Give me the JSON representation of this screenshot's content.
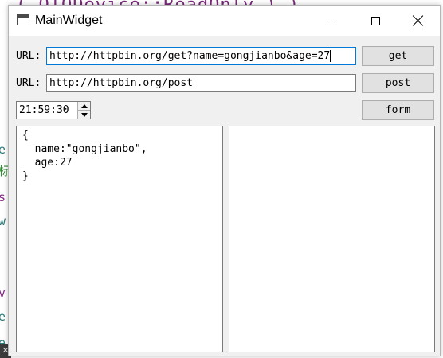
{
  "window": {
    "title": "MainWidget",
    "icon": "app-window-icon"
  },
  "background": {
    "top_text": "( QIODevice::ReadOnly ) )",
    "side_chars": [
      "e",
      "标",
      "s",
      "w",
      "",
      "v",
      "e",
      "e"
    ]
  },
  "row1": {
    "label": "URL:",
    "value": "http://httpbin.org/get?name=gongjianbo&age=27",
    "button": "get"
  },
  "row2": {
    "label": "URL:",
    "value": "http://httpbin.org/post",
    "button": "post"
  },
  "row3": {
    "time": "21:59:30",
    "button": "form"
  },
  "left_pane": {
    "text": "{\n  name:\"gongjianbo\",\n  age:27\n}"
  },
  "right_pane": {
    "text": ""
  },
  "colors": {
    "focus_border": "#0078d7",
    "button_bg": "#e1e1e1",
    "window_bg": "#f0f0f0"
  }
}
